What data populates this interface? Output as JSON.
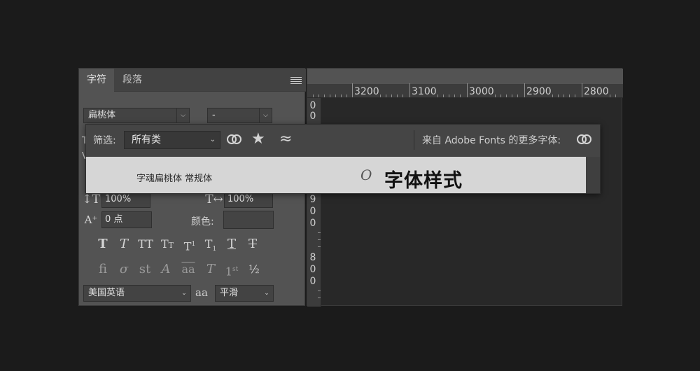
{
  "panel": {
    "tabs": [
      "字符",
      "段落"
    ],
    "font_family": "扁桃体",
    "font_style": "-",
    "vertical_scale": "100%",
    "horizontal_scale": "100%",
    "baseline_shift": "0 点",
    "color_label": "颜色:",
    "language": "美国英语",
    "aa_label": "aa",
    "antialias": "平滑"
  },
  "popup": {
    "filter_label": "筛选:",
    "filter_value": "所有类",
    "more_fonts_label": "来自 Adobe Fonts 的更多字体:",
    "font_row": {
      "name": "字魂扁桃体 常规体",
      "type_icon": "O",
      "sample": "字体样式"
    }
  },
  "ruler": {
    "horizontal": [
      "3200",
      "3100",
      "3000",
      "2900",
      "2800"
    ],
    "vertical": [
      "9",
      "0",
      "0",
      "8",
      "0",
      "0"
    ]
  },
  "icons": {
    "type_style": [
      "faux-bold-icon",
      "faux-italic-icon",
      "all-caps-icon",
      "small-caps-icon",
      "superscript-icon",
      "subscript-icon",
      "underline-icon",
      "strikethrough-icon"
    ],
    "opentype": [
      "ligatures-icon",
      "discretionary-ligatures-icon",
      "historical-ligature-icon",
      "swash-icon",
      "stylistic-alternates-icon",
      "titling-icon",
      "ordinals-icon",
      "fractions-icon"
    ]
  }
}
